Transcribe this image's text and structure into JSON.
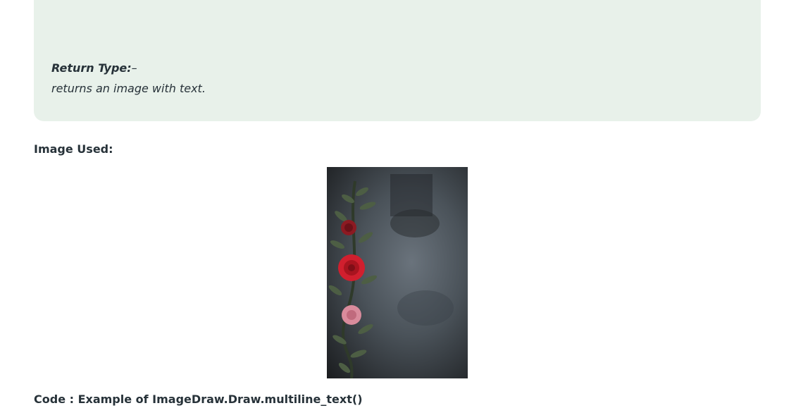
{
  "return_type": {
    "label": "Return Type:",
    "separator": "–",
    "description": "returns an image with text."
  },
  "image_section": {
    "heading": "Image Used:"
  },
  "code_section": {
    "heading": "Code : Example of ImageDraw.Draw.multiline_text()"
  },
  "colors": {
    "info_box_bg": "#e8f1ea",
    "text": "#273239"
  }
}
